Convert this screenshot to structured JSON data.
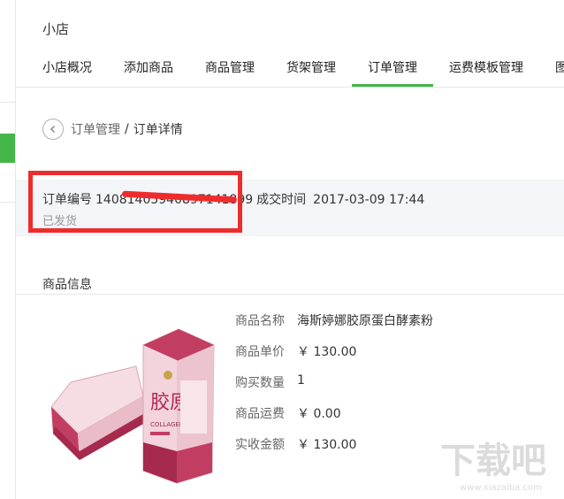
{
  "header": {
    "store_title": "小店"
  },
  "tabs": [
    {
      "label": "小店概况"
    },
    {
      "label": "添加商品"
    },
    {
      "label": "商品管理"
    },
    {
      "label": "货架管理"
    },
    {
      "label": "订单管理",
      "active": true
    },
    {
      "label": "运费模板管理"
    },
    {
      "label": "图"
    }
  ],
  "breadcrumb": {
    "parent": "订单管理",
    "separator": "/",
    "current": "订单详情"
  },
  "order": {
    "number_label": "订单编号",
    "number_value": "14081405940897141899",
    "time_label": "成交时间",
    "time_value": "2017-03-09 17:44",
    "status": "已发货"
  },
  "product_section": {
    "title": "商品信息"
  },
  "product": {
    "rows": [
      {
        "label": "商品名称",
        "value": "海斯婷娜胶原蛋白酵素粉"
      },
      {
        "label": "商品单价",
        "value": "￥ 130.00"
      },
      {
        "label": "购买数量",
        "value": "1"
      },
      {
        "label": "商品运费",
        "value": "￥ 0.00"
      },
      {
        "label": "实收金额",
        "value": "￥ 130.00"
      }
    ],
    "package_text": {
      "brand": "胶原",
      "sub": "COLLAGEN"
    }
  },
  "watermark": {
    "text": "下载吧",
    "url": "www.xiazaiba.com"
  },
  "colors": {
    "accent": "#44b549",
    "highlight": "#ee2c2c",
    "panel": "#f4f5f9"
  }
}
